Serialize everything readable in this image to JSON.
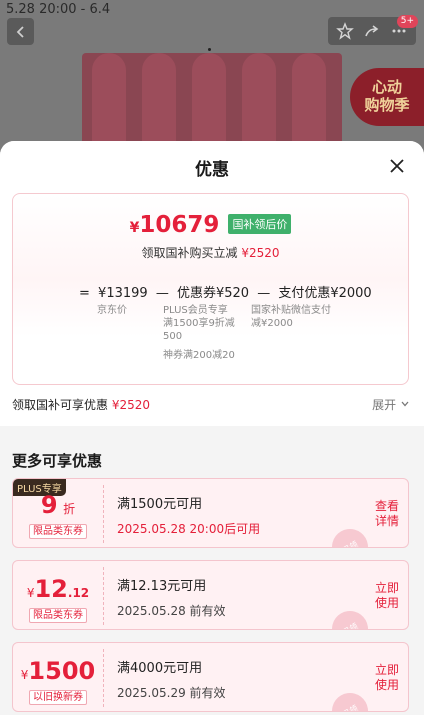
{
  "background": {
    "date_range": "5.28 20:00 - 6.4",
    "badge": "5+",
    "banner_text": [
      "心动",
      "购物季"
    ]
  },
  "sheet": {
    "title": "优惠",
    "summary": {
      "currency": "¥",
      "final_price": "10679",
      "final_tag": "国补领后价",
      "subsidy_text": "领取国补购买立减",
      "subsidy_amount": "¥2520",
      "formula": {
        "eq": "=",
        "original": "¥13199",
        "minus1": "—",
        "coupon": "优惠券¥520",
        "minus2": "—",
        "payment": "支付优惠¥2000"
      },
      "col1": "京东价",
      "col2": [
        "PLUS会员专享",
        "满1500享9折减",
        "500",
        "",
        "神券满200减20"
      ],
      "col3": [
        "国家补贴微信支付",
        "减¥2000"
      ]
    },
    "bottom_line_label": "领取国补可享优惠",
    "bottom_line_amount": "¥2520",
    "expand_label": "展开",
    "more_title": "更多可享优惠",
    "coupons": [
      {
        "plus_tag": "PLUS专享",
        "amount": "9",
        "unit": "折",
        "type": "限品类东券",
        "condition": "满1500元可用",
        "time": "2025.05.28 20:00后可用",
        "button": "查看详情",
        "stamp": "已领"
      },
      {
        "currency": "¥",
        "amount": "12",
        "decimals": ".12",
        "type": "限品类东券",
        "condition": "满12.13元可用",
        "time": "2025.05.28 前有效",
        "button": "立即使用",
        "stamp": "已领"
      },
      {
        "currency": "¥",
        "amount": "1500",
        "type": "以旧换新券",
        "condition": "满4000元可用",
        "time": "2025.05.29 前有效",
        "button": "立即使用",
        "stamp": "已领"
      }
    ]
  },
  "colors": {
    "accent": "#e4203a",
    "tag_green": "#3fb06b",
    "coupon_bg": "#fff1f3"
  }
}
